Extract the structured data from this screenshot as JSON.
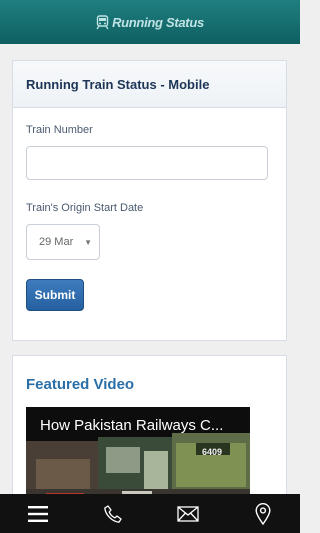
{
  "header": {
    "brand": "Running Status"
  },
  "form": {
    "title": "Running Train Status - Mobile",
    "train_label": "Train Number",
    "train_value": "",
    "date_label": "Train's Origin Start Date",
    "date_value": "29 Mar",
    "submit_label": "Submit"
  },
  "featured": {
    "title": "Featured Video",
    "video_title": "How Pakistan Railways C...",
    "video_caption": "6409"
  },
  "bottom_nav": {
    "icons": [
      "menu-icon",
      "phone-icon",
      "mail-icon",
      "location-pin-icon"
    ]
  }
}
